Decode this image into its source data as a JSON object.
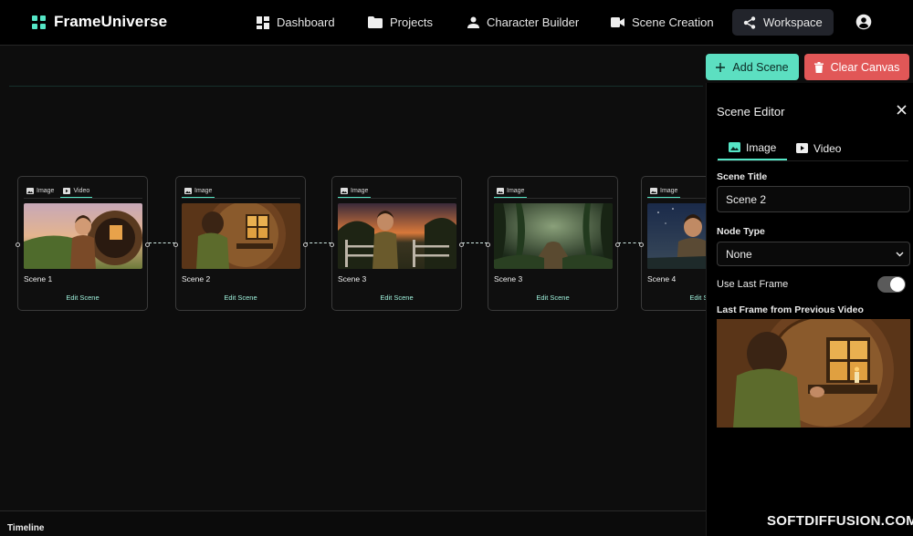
{
  "app": {
    "name": "FrameUniverse"
  },
  "nav": {
    "items": [
      {
        "label": "Dashboard",
        "icon": "dashboard-icon"
      },
      {
        "label": "Projects",
        "icon": "folder-icon"
      },
      {
        "label": "Character Builder",
        "icon": "person-icon"
      },
      {
        "label": "Scene Creation",
        "icon": "video-camera-icon"
      },
      {
        "label": "Workspace",
        "icon": "workspace-icon",
        "active": true
      }
    ],
    "account_icon": "account-circle-icon"
  },
  "toolbar": {
    "add_label": "Add Scene",
    "clear_label": "Clear Canvas"
  },
  "colors": {
    "accent": "#55e6c6",
    "danger": "#e15757",
    "background": "#0d0d0d"
  },
  "nodes": [
    {
      "title": "Scene 1",
      "edit_label": "Edit Scene",
      "tabs": [
        "Image",
        "Video"
      ],
      "active_tab": "Video"
    },
    {
      "title": "Scene 2",
      "edit_label": "Edit Scene",
      "tabs": [
        "Image"
      ],
      "active_tab": "Image"
    },
    {
      "title": "Scene 3",
      "edit_label": "Edit Scene",
      "tabs": [
        "Image"
      ],
      "active_tab": "Image"
    },
    {
      "title": "Scene 3",
      "edit_label": "Edit Scene",
      "tabs": [
        "Image"
      ],
      "active_tab": "Image"
    },
    {
      "title": "Scene 4",
      "edit_label": "Edit Scene",
      "tabs": [
        "Image"
      ],
      "active_tab": "Image"
    }
  ],
  "timeline": {
    "label": "Timeline"
  },
  "editor": {
    "title": "Scene Editor",
    "tabs": [
      {
        "label": "Image",
        "icon": "image-icon",
        "active": true
      },
      {
        "label": "Video",
        "icon": "play-icon"
      }
    ],
    "scene_title_label": "Scene Title",
    "scene_title_value": "Scene 2",
    "node_type_label": "Node Type",
    "node_type_value": "None",
    "use_last_frame_label": "Use Last Frame",
    "use_last_frame": true,
    "last_frame_label": "Last Frame from Previous Video"
  },
  "watermark": "SOFTDIFFUSION.COM"
}
